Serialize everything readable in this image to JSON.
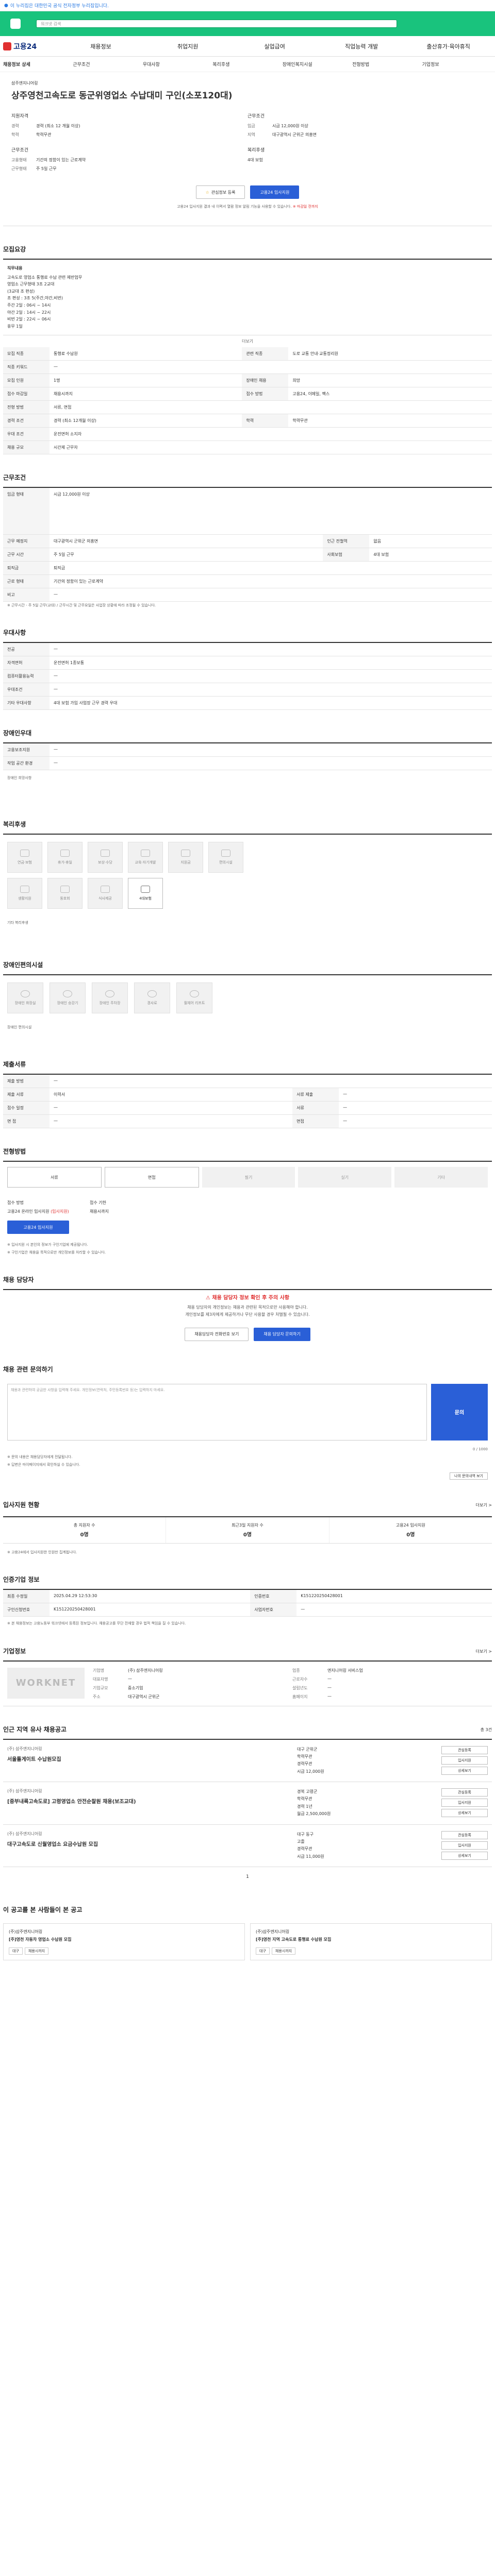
{
  "topbar": {
    "text": "이 누리집은 대한민국 공식 전자정부 누리집입니다."
  },
  "search": {
    "placeholder": "워크넷 검색"
  },
  "gnb": {
    "logo": "고용24",
    "items": [
      "채용정보",
      "취업지원",
      "실업급여",
      "직업능력 개발",
      "출산휴가·육아휴직"
    ]
  },
  "subnav": [
    "채용정보 상세",
    "근무조건",
    "우대사항",
    "복리후생",
    "장애인복지시설",
    "전형방법",
    "기업정보"
  ],
  "job": {
    "company": "삼주엔지니어링",
    "title": "상주영천고속도로 동군위영업소 수납대미 구인(소포120대)",
    "qual_head": "지원자격",
    "work_head": "근무조건",
    "qual": [
      {
        "k": "경력",
        "v": "경력 (최소 12 개월 이상)"
      },
      {
        "k": "학력",
        "v": "학력무관"
      }
    ],
    "work": [
      {
        "k": "임금",
        "v": "시급 12,000원 이상"
      },
      {
        "k": "지역",
        "v": "대구광역시 군위군 의흥면"
      }
    ],
    "work2": [
      {
        "k": "고용형태",
        "v": "기간의 정함이 있는 근로계약"
      },
      {
        "k": "근무형태",
        "v": "주 5일 근무"
      }
    ],
    "work3": [
      {
        "k": "복리후생",
        "v": "4대 보험"
      }
    ],
    "btn_scrap": "관심정보 등록",
    "btn_apply": "고용24 입사지원",
    "note_pre": "고용24 입사지원 결과 내 이력서 열람 정보 알림 기능을 사용할 수 있습니다.",
    "note_red": "※ 마감일 전까지"
  },
  "recruit": {
    "title": "모집요강",
    "desc_head": "직무내용",
    "desc": [
      "고속도로 영업소 통행료 수납 관련 제반업무",
      "영업소 근무형태 3조 2교대",
      "(3교대 조 편성)",
      "조 편성 : 3조 5(주간,야간,비번)",
      "주간 2일 : 06시 ~ 14시",
      "야간 2일 : 14시 ~ 22시",
      "비번 2일 : 22시 ~ 06시",
      "휴무 1일"
    ],
    "more": "더보기",
    "rows": [
      [
        "모집 직종",
        "통행료 수납원",
        "관련 직종",
        "도로 교통 안내·교통정리원"
      ],
      [
        "직종 키워드",
        "—",
        "",
        ""
      ],
      [
        "모집 인원",
        "1명",
        "장애인 채용",
        "희망"
      ],
      [
        "접수 마감일",
        "채용시까지",
        "접수 방법",
        "고용24, 이메일, 팩스"
      ],
      [
        "전형 방법",
        "서류, 면접",
        "",
        ""
      ],
      [
        "경력 조건",
        "경력 (최소 12개월 이상)",
        "학력",
        "학력무관"
      ],
      [
        "우대 조건",
        "운전면허 소지자",
        "",
        ""
      ],
      [
        "채용 규모",
        "시간제 근무자",
        "",
        ""
      ]
    ]
  },
  "conditions": {
    "title": "근무조건",
    "wage_k": "임금 형태",
    "wage_v": "시급 12,000원 이상",
    "rows": [
      [
        "근무 예정지",
        "대구광역시 군위군 의흥면",
        "인근 전철역",
        "없음"
      ],
      [
        "근무 시간",
        "주 5일 근무",
        "사회보험",
        "4대 보험"
      ],
      [
        "퇴직금",
        "퇴직금",
        "",
        ""
      ],
      [
        "근로 형태",
        "기간의 정함이 있는 근로계약",
        "",
        ""
      ],
      [
        "비고",
        "—",
        "",
        ""
      ]
    ],
    "footnote": "※ 근무시간 - 주 5일 근무(교대) / 근무시간 및 근무요일은 사업장 상황에 따라 조정될 수 있습니다."
  },
  "preferences": {
    "title": "우대사항",
    "rows": [
      [
        "전공",
        "—"
      ],
      [
        "자격면허",
        "운전면허 1종보통"
      ],
      [
        "컴퓨터활용능력",
        "—"
      ],
      [
        "우대조건",
        "—"
      ],
      [
        "기타 우대사항",
        "4대 보험 가입 사업장 근무 경력 우대"
      ]
    ]
  },
  "disabled": {
    "title": "장애인우대",
    "rows": [
      [
        "고용보조지원",
        "—"
      ],
      [
        "작업 공간 환경",
        "—"
      ]
    ],
    "note": "장애인 희망사항"
  },
  "welfare": {
    "title": "복리후생",
    "tiles": [
      "연금·보험",
      "휴가·휴일",
      "보상·수당",
      "교육·자기개발",
      "지원금",
      "편의시설",
      "생활지원",
      "동호회",
      "식사제공",
      "4대보험"
    ],
    "active": 9,
    "extra": "기타 복리후생"
  },
  "facilities": {
    "title": "장애인편의시설",
    "tiles": [
      "장애인 화장실",
      "장애인 승강기",
      "장애인 주차장",
      "경사로",
      "휠체어 리프트"
    ],
    "extra": "장애인 편의시설"
  },
  "docs": {
    "title": "제출서류",
    "rows": [
      [
        "제출 방법",
        "—",
        "",
        ""
      ],
      [
        "제출 서류",
        "이력서",
        "서류 제출",
        "—"
      ],
      [
        "접수 일정",
        "—",
        "서류",
        "—"
      ],
      [
        "면 접",
        "—",
        "면접",
        "—"
      ]
    ]
  },
  "selection": {
    "title": "전형방법",
    "steps": [
      "서류",
      "면접",
      "필기",
      "실기",
      "기타"
    ],
    "active_count": 2,
    "apply_head": "접수 방법",
    "apply_val": "고용24 온라인 입사지원",
    "apply_red": "(입사지원)",
    "deadline_head": "접수 기한",
    "deadline_val": "채용시까지",
    "btn_apply": "고용24 입사지원",
    "notes": [
      "※ 입사지원 시 본인의 정보가 구인기업에 제공됩니다.",
      "※ 구인기업은 채용을 목적으로만 개인정보를 처리할 수 있습니다."
    ]
  },
  "contact": {
    "title": "채용 담당자",
    "red": "채용 담당자 정보 확인 후 주의 사항",
    "info": [
      "채용 담당자의 개인정보는 채용과 관련된 목적으로만 사용해야 합니다.",
      "개인정보를 제3자에게 제공하거나 무단 사용할 경우 처벌될 수 있습니다."
    ],
    "btn_tel": "채용담당자 전화번호 보기",
    "btn_mail": "채용 담당자 문의하기"
  },
  "inquiry": {
    "title": "채용 관련 문의하기",
    "placeholder": "채용과 관련하여 궁금한 사항을 입력해 주세요. 개인정보(연락처, 주민등록번호 등)는 입력하지 마세요.",
    "counter": "0 / 1000",
    "btn": "문의",
    "notes": [
      "※ 문의 내용은 채용담당자에게 전달됩니다.",
      "※ 답변은 마이페이지에서 확인하실 수 있습니다."
    ],
    "btn_list": "나의 문의내역 보기"
  },
  "stats": {
    "title": "입사지원 현황",
    "more": "더보기 >",
    "items": [
      {
        "label": "총 지원자 수",
        "val": "0명"
      },
      {
        "label": "최근3일 지원자 수",
        "val": "0명"
      },
      {
        "label": "고용24 입사지원",
        "val": "0명"
      }
    ],
    "note": "※ 고용24에서 입사지원한 인원만 집계됩니다."
  },
  "regist": {
    "title": "인증기업 정보",
    "rows": [
      [
        "최종 수정일",
        "2025.04.29 12:53:30",
        "인증번호",
        "K151220250428001"
      ],
      [
        "구인신청번호",
        "K151220250428001",
        "사업자번호",
        "—"
      ]
    ],
    "note": "※ 본 채용정보는 고용노동부 워크넷에서 등록된 정보입니다. 채용공고를 무단 전재할 경우 법적 책임을 질 수 있습니다."
  },
  "company": {
    "title": "기업정보",
    "more": "더보기 >",
    "logo": "WORKNET",
    "rows": [
      [
        "기업명",
        "(주) 삼주엔지니어링",
        "업종",
        "엔지니어링 서비스업"
      ],
      [
        "대표자명",
        "—",
        "근로자수",
        "—"
      ],
      [
        "기업규모",
        "중소기업",
        "설립년도",
        "—"
      ],
      [
        "주소",
        "대구광역시 군위군",
        "홈페이지",
        "—"
      ]
    ]
  },
  "other_jobs": {
    "title": "인근 지역 유사 채용공고",
    "count": "총 3건",
    "jobs": [
      {
        "company": "(주) 삼주엔지니어링",
        "title": "서울톨게이트 수납원모집",
        "loc": "대구 군위군",
        "edu": "학력무관",
        "career": "경력무관",
        "pay": "시급 12,000원",
        "btns": [
          "관심등록",
          "입사지원",
          "상세보기"
        ]
      },
      {
        "company": "(주) 삼주엔지니어링",
        "title": "[중부내륙고속도로] 고령영업소 안전순찰원 채용(보조교대)",
        "loc": "경북 고령군",
        "edu": "학력무관",
        "career": "경력 1년",
        "pay": "월급 2,500,000원",
        "btns": [
          "관심등록",
          "입사지원",
          "상세보기"
        ]
      },
      {
        "company": "(주) 삼주엔지니어링",
        "title": "대구고속도로 신월영업소 요금수납원 모집",
        "loc": "대구 동구",
        "edu": "고졸",
        "career": "경력무관",
        "pay": "시급 11,000원",
        "btns": [
          "관심등록",
          "입사지원",
          "상세보기"
        ]
      }
    ],
    "page": "1"
  },
  "reco": {
    "title": "이 공고를 본 사람들이 본 공고",
    "items": [
      {
        "company": "(주)삼주엔지니어링",
        "title": "[주]영천 자동차 영업소 수납원 모집",
        "tags": [
          "대구",
          "채용시까지"
        ]
      },
      {
        "company": "(주)삼주엔지니어링",
        "title": "[주]영천 지역 고속도로 통행료 수납원 모집",
        "tags": [
          "대구",
          "채용시까지"
        ]
      }
    ]
  }
}
